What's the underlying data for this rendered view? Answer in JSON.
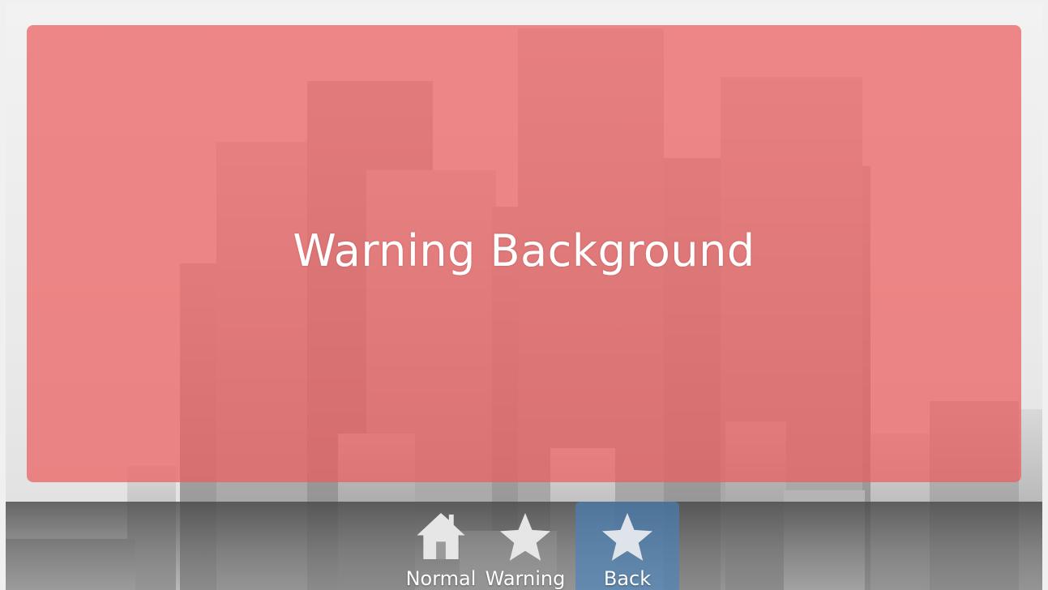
{
  "panel": {
    "title": "Warning Background",
    "color": "#ec5d5d"
  },
  "appbar": {
    "buttons": [
      {
        "label": "Normal",
        "icon": "home-icon",
        "active": false
      },
      {
        "label": "Warning",
        "icon": "star-icon",
        "active": false
      },
      {
        "label": "Back",
        "icon": "star-icon",
        "active": true
      }
    ],
    "active_color": "#4682be"
  }
}
